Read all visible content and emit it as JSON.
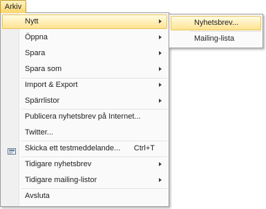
{
  "menubar": {
    "arkiv_label": "Arkiv"
  },
  "menu": {
    "items": [
      {
        "label": "Nytt",
        "has_submenu": true,
        "highlighted": true
      },
      {
        "label": "Öppna",
        "has_submenu": true
      },
      {
        "label": "Spara",
        "has_submenu": true
      },
      {
        "label": "Spara som",
        "has_submenu": true
      },
      {
        "label": "Import & Export",
        "has_submenu": true
      },
      {
        "label": "Spärrlistor",
        "has_submenu": true
      },
      {
        "label": "Publicera nyhetsbrev på Internet..."
      },
      {
        "label": "Twitter..."
      },
      {
        "label": "Skicka ett testmeddelande...",
        "shortcut": "Ctrl+T",
        "icon": "send-test-email-icon"
      },
      {
        "label": "Tidigare nyhetsbrev",
        "has_submenu": true
      },
      {
        "label": "Tidigare mailing-listor",
        "has_submenu": true
      },
      {
        "label": "Avsluta"
      }
    ]
  },
  "submenu": {
    "items": [
      {
        "label": "Nyhetsbrev...",
        "highlighted": true
      },
      {
        "label": "Mailing-lista"
      }
    ]
  },
  "colors": {
    "highlight_top": "#fffbe1",
    "highlight_bottom": "#ffe391",
    "highlight_border": "#e6c15a",
    "menu_border": "#9a9a9a"
  }
}
